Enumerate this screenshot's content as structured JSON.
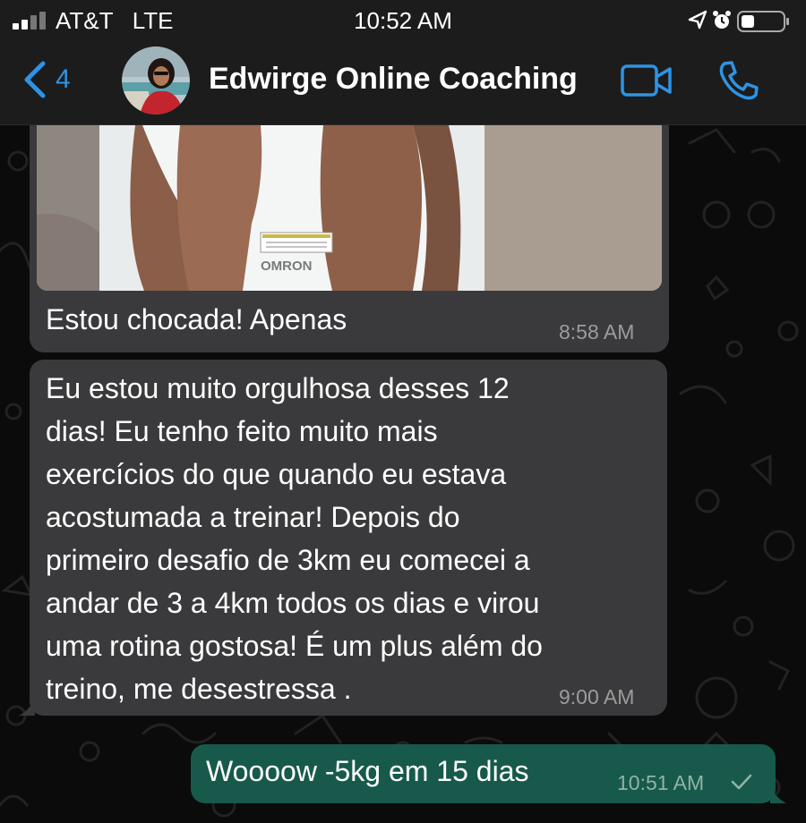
{
  "status_bar": {
    "carrier": "AT&T   LTE",
    "time": "10:52 AM"
  },
  "header": {
    "back_count": "4",
    "title": "Edwirge Online Coaching",
    "accent_color": "#2e93e4"
  },
  "photo": {
    "scale_brand": "OMRON"
  },
  "messages": [
    {
      "direction": "incoming",
      "lines": [
        "Estou chocada! Apenas"
      ],
      "time": "8:58 AM"
    },
    {
      "direction": "incoming",
      "lines": [
        "Eu estou muito orgulhosa desses 12",
        "dias! Eu tenho feito muito mais",
        "exercícios do que quando eu estava",
        "acostumada a treinar! Depois do",
        "primeiro desafio de 3km eu comecei a",
        "andar de 3 a 4km todos os dias e virou",
        "uma rotina gostosa! É um plus além do",
        "treino, me desestressa ."
      ],
      "time": "9:00 AM"
    },
    {
      "direction": "outgoing",
      "lines": [
        "Woooow -5kg em 15 dias"
      ],
      "time": "10:51 AM",
      "status_icon": "single-check-icon"
    }
  ],
  "colors": {
    "incoming_bubble": "#3a3a3c",
    "outgoing_bubble": "#175a4b"
  }
}
